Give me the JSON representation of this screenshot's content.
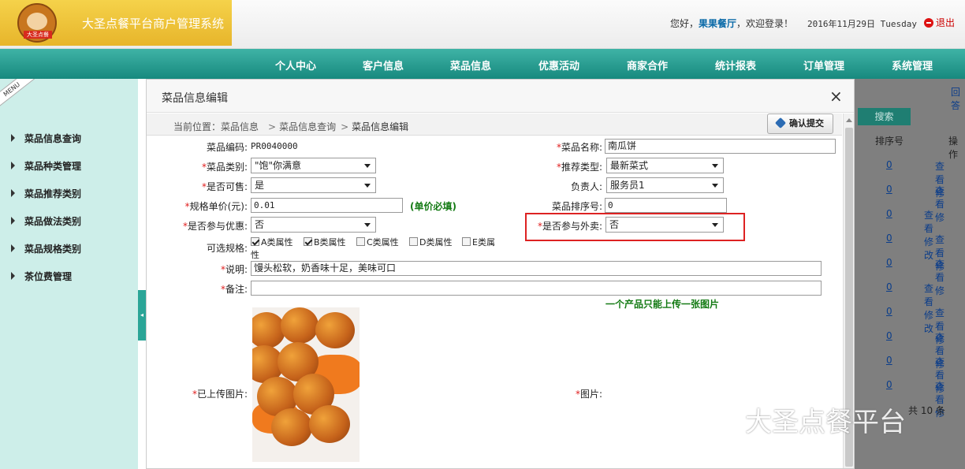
{
  "header": {
    "brand_title": "大圣点餐平台商户管理系统",
    "logo_text": "大圣点餐",
    "greeting": "您好，",
    "restaurant": "果果餐厅",
    "welcome_suffix": "，欢迎登录！",
    "date": "2016年11月29日 Tuesday",
    "logout": "退出"
  },
  "nav": {
    "items": [
      "个人中心",
      "客户信息",
      "菜品信息",
      "优惠活动",
      "商家合作",
      "统计报表",
      "订单管理",
      "系统管理"
    ]
  },
  "sidebar": {
    "menu_tag": "MENU",
    "items": [
      "菜品信息查询",
      "菜品种类管理",
      "菜品推荐类别",
      "菜品做法类别",
      "菜品规格类别",
      "茶位费管理"
    ]
  },
  "background": {
    "back_link": "回答",
    "search_button": "搜索",
    "col_sort": "排序号",
    "col_op": "操作",
    "row_num": "0",
    "view": "查看",
    "modify_short": "修",
    "view_modify": "查看 修改",
    "footer": "共 10 条"
  },
  "dialog": {
    "title": "菜品信息编辑",
    "close": "×",
    "crumb_label": "当前位置：",
    "crumbs": [
      "菜品信息",
      "菜品信息查询",
      "菜品信息编辑"
    ],
    "crumb_sep": ">",
    "confirm_button": "确认提交",
    "fields": {
      "code_label": "菜品编码:",
      "code_value": "PR0040000",
      "name_label": "菜品名称:",
      "name_value": "南瓜饼",
      "category_label": "菜品类别:",
      "category_value": "\"饱\"你满意",
      "recommend_label": "推荐类型:",
      "recommend_value": "最新菜式",
      "sellable_label": "是否可售:",
      "sellable_value": "是",
      "owner_label": "负责人:",
      "owner_value": "服务员1",
      "price_label": "规格单价(元):",
      "price_value": "0.01",
      "price_hint": "(单价必填)",
      "sort_label": "菜品排序号:",
      "sort_value": "0",
      "discount_label": "是否参与优惠:",
      "discount_value": "否",
      "takeout_label": "是否参与外卖:",
      "takeout_value": "否",
      "spec_label": "可选规格:",
      "specs": [
        {
          "label": "A类属性",
          "checked": true
        },
        {
          "label": "B类属性",
          "checked": true
        },
        {
          "label": "C类属性",
          "checked": false
        },
        {
          "label": "D类属性",
          "checked": false
        },
        {
          "label": "E类属",
          "checked": false
        }
      ],
      "spec_wrap": "性",
      "desc_label": "说明:",
      "desc_value": "馒头松软，奶香味十足，美味可口",
      "remark_label": "备注:",
      "remark_value": "",
      "upload_hint": "一个产品只能上传一张图片",
      "uploaded_label": "已上传图片:",
      "image_label": "图片:",
      "required_mark": "*"
    }
  },
  "watermark": "大圣点餐平台"
}
